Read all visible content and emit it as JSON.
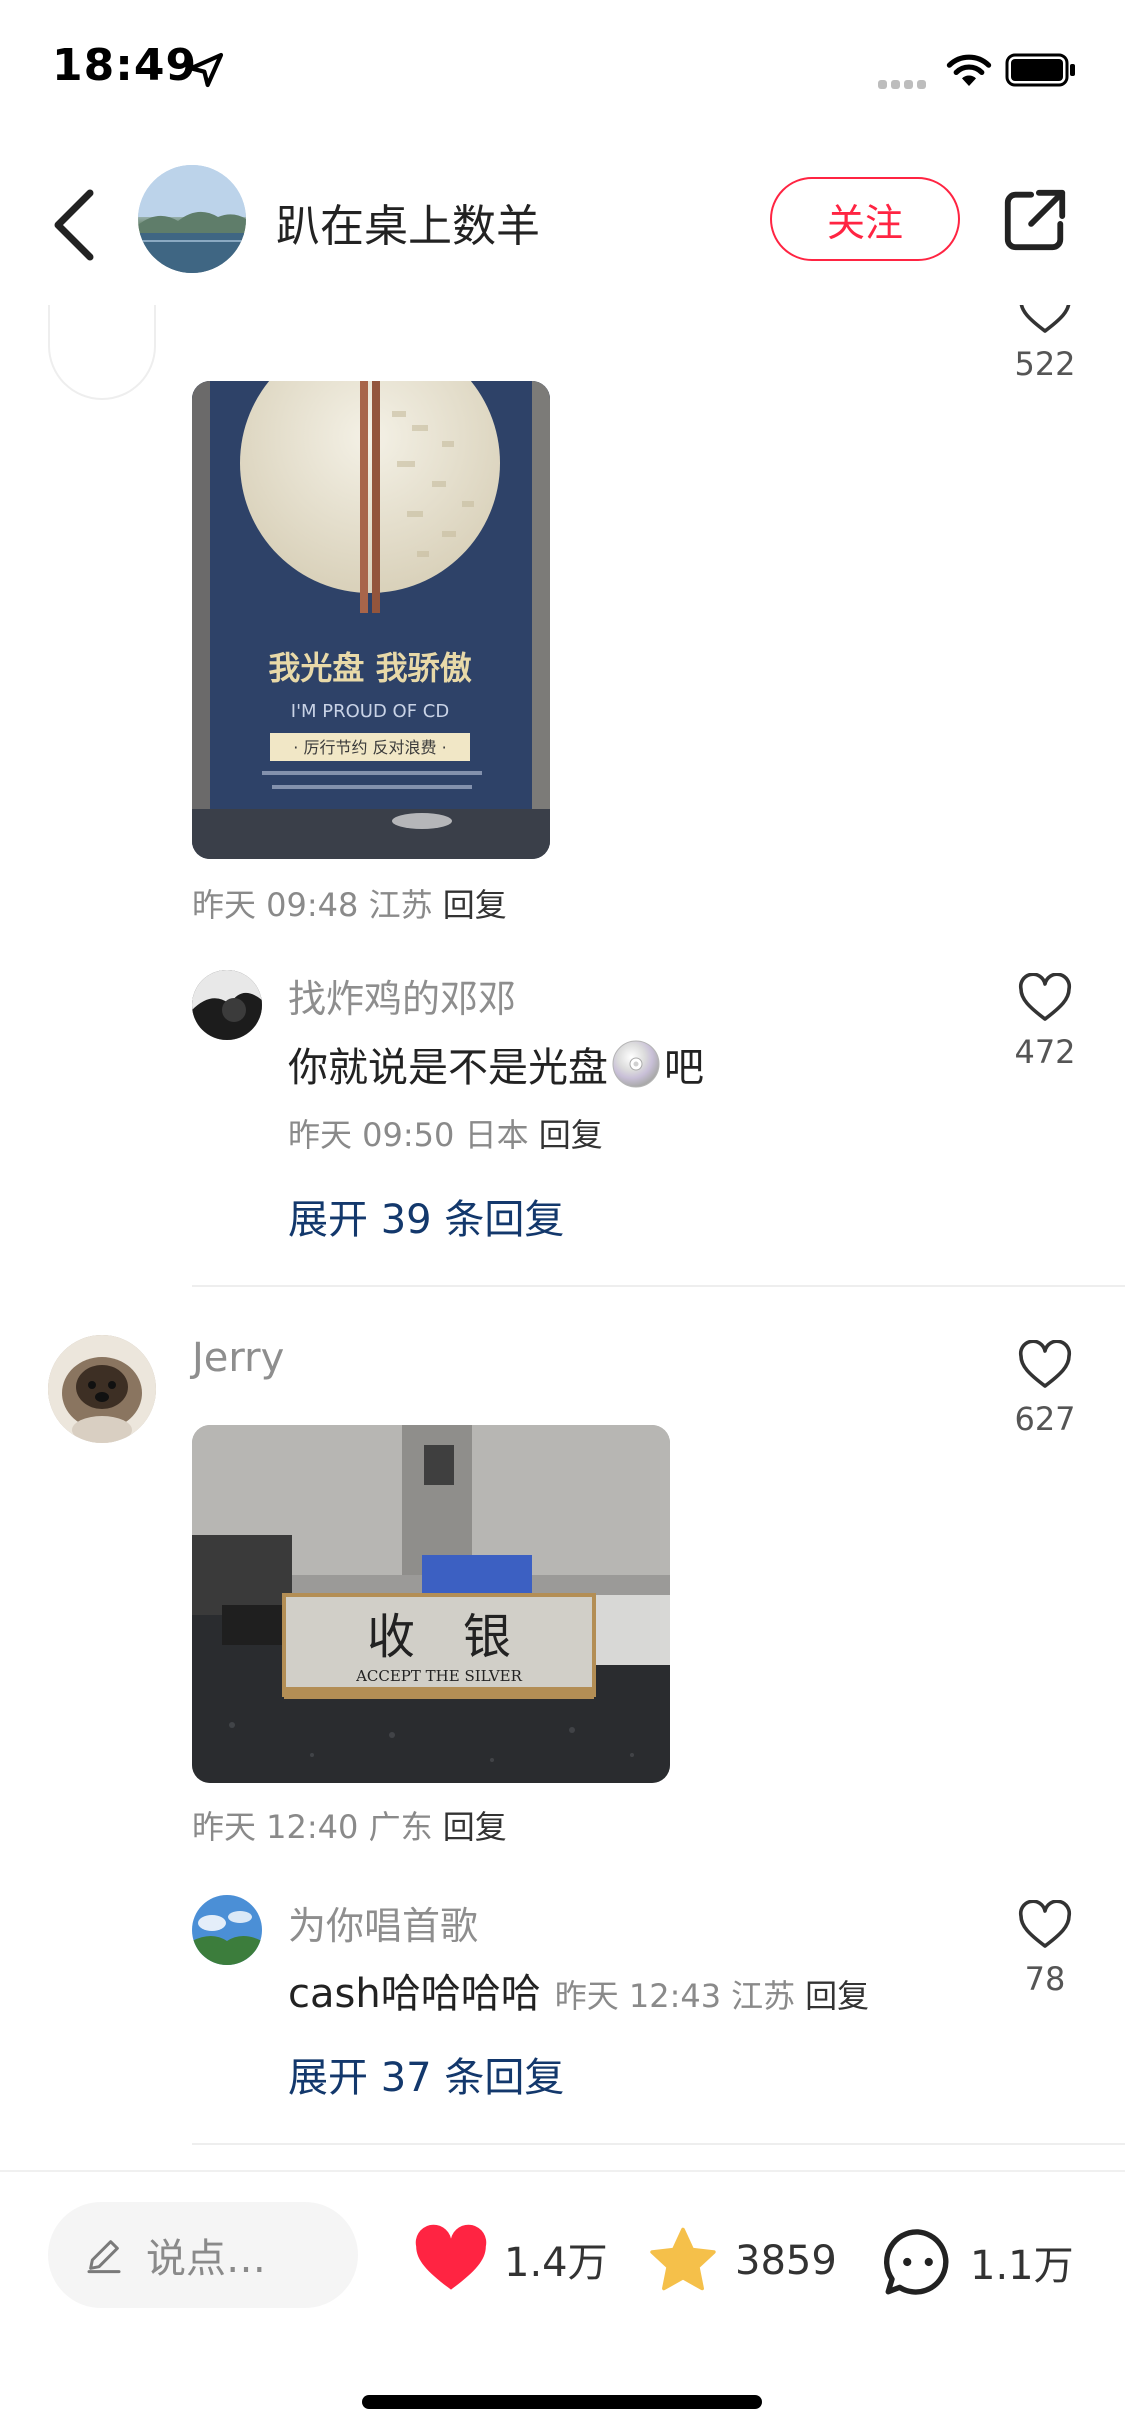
{
  "status_bar": {
    "time": "18:49"
  },
  "header": {
    "author_name": "趴在桌上数羊",
    "follow_label": "关注"
  },
  "comments": [
    {
      "like_count": "522",
      "image_text": {
        "line1": "我光盘 我骄傲",
        "line2": "I'M PROUD OF CD",
        "line3": "· 厉行节约  反对浪费 ·"
      },
      "meta_time": "昨天 09:48",
      "meta_location": "江苏",
      "reply_label": "回复",
      "sub_reply": {
        "username": "找炸鸡的邓邓",
        "text_before": "你就说是不是光盘",
        "text_after": "吧",
        "meta_time": "昨天 09:50",
        "meta_location": "日本",
        "reply_label": "回复",
        "like_count": "472"
      },
      "expand_label": "展开 39 条回复"
    },
    {
      "username": "Jerry",
      "like_count": "627",
      "image_text": {
        "line1": "收　银",
        "line2": "ACCEPT THE SILVER"
      },
      "meta_time": "昨天 12:40",
      "meta_location": "广东",
      "reply_label": "回复",
      "sub_reply": {
        "username": "为你唱首歌",
        "text": "cash哈哈哈哈",
        "meta_time": "昨天 12:43",
        "meta_location": "江苏",
        "reply_label": "回复",
        "like_count": "78"
      },
      "expand_label": "展开 37 条回复"
    }
  ],
  "bottom_bar": {
    "input_placeholder": "说点…",
    "likes": "1.4万",
    "collects": "3859",
    "comments": "1.1万"
  },
  "colors": {
    "accent_red": "#ff2442",
    "link_blue": "#13386c",
    "star_yellow": "#f5c04a"
  }
}
